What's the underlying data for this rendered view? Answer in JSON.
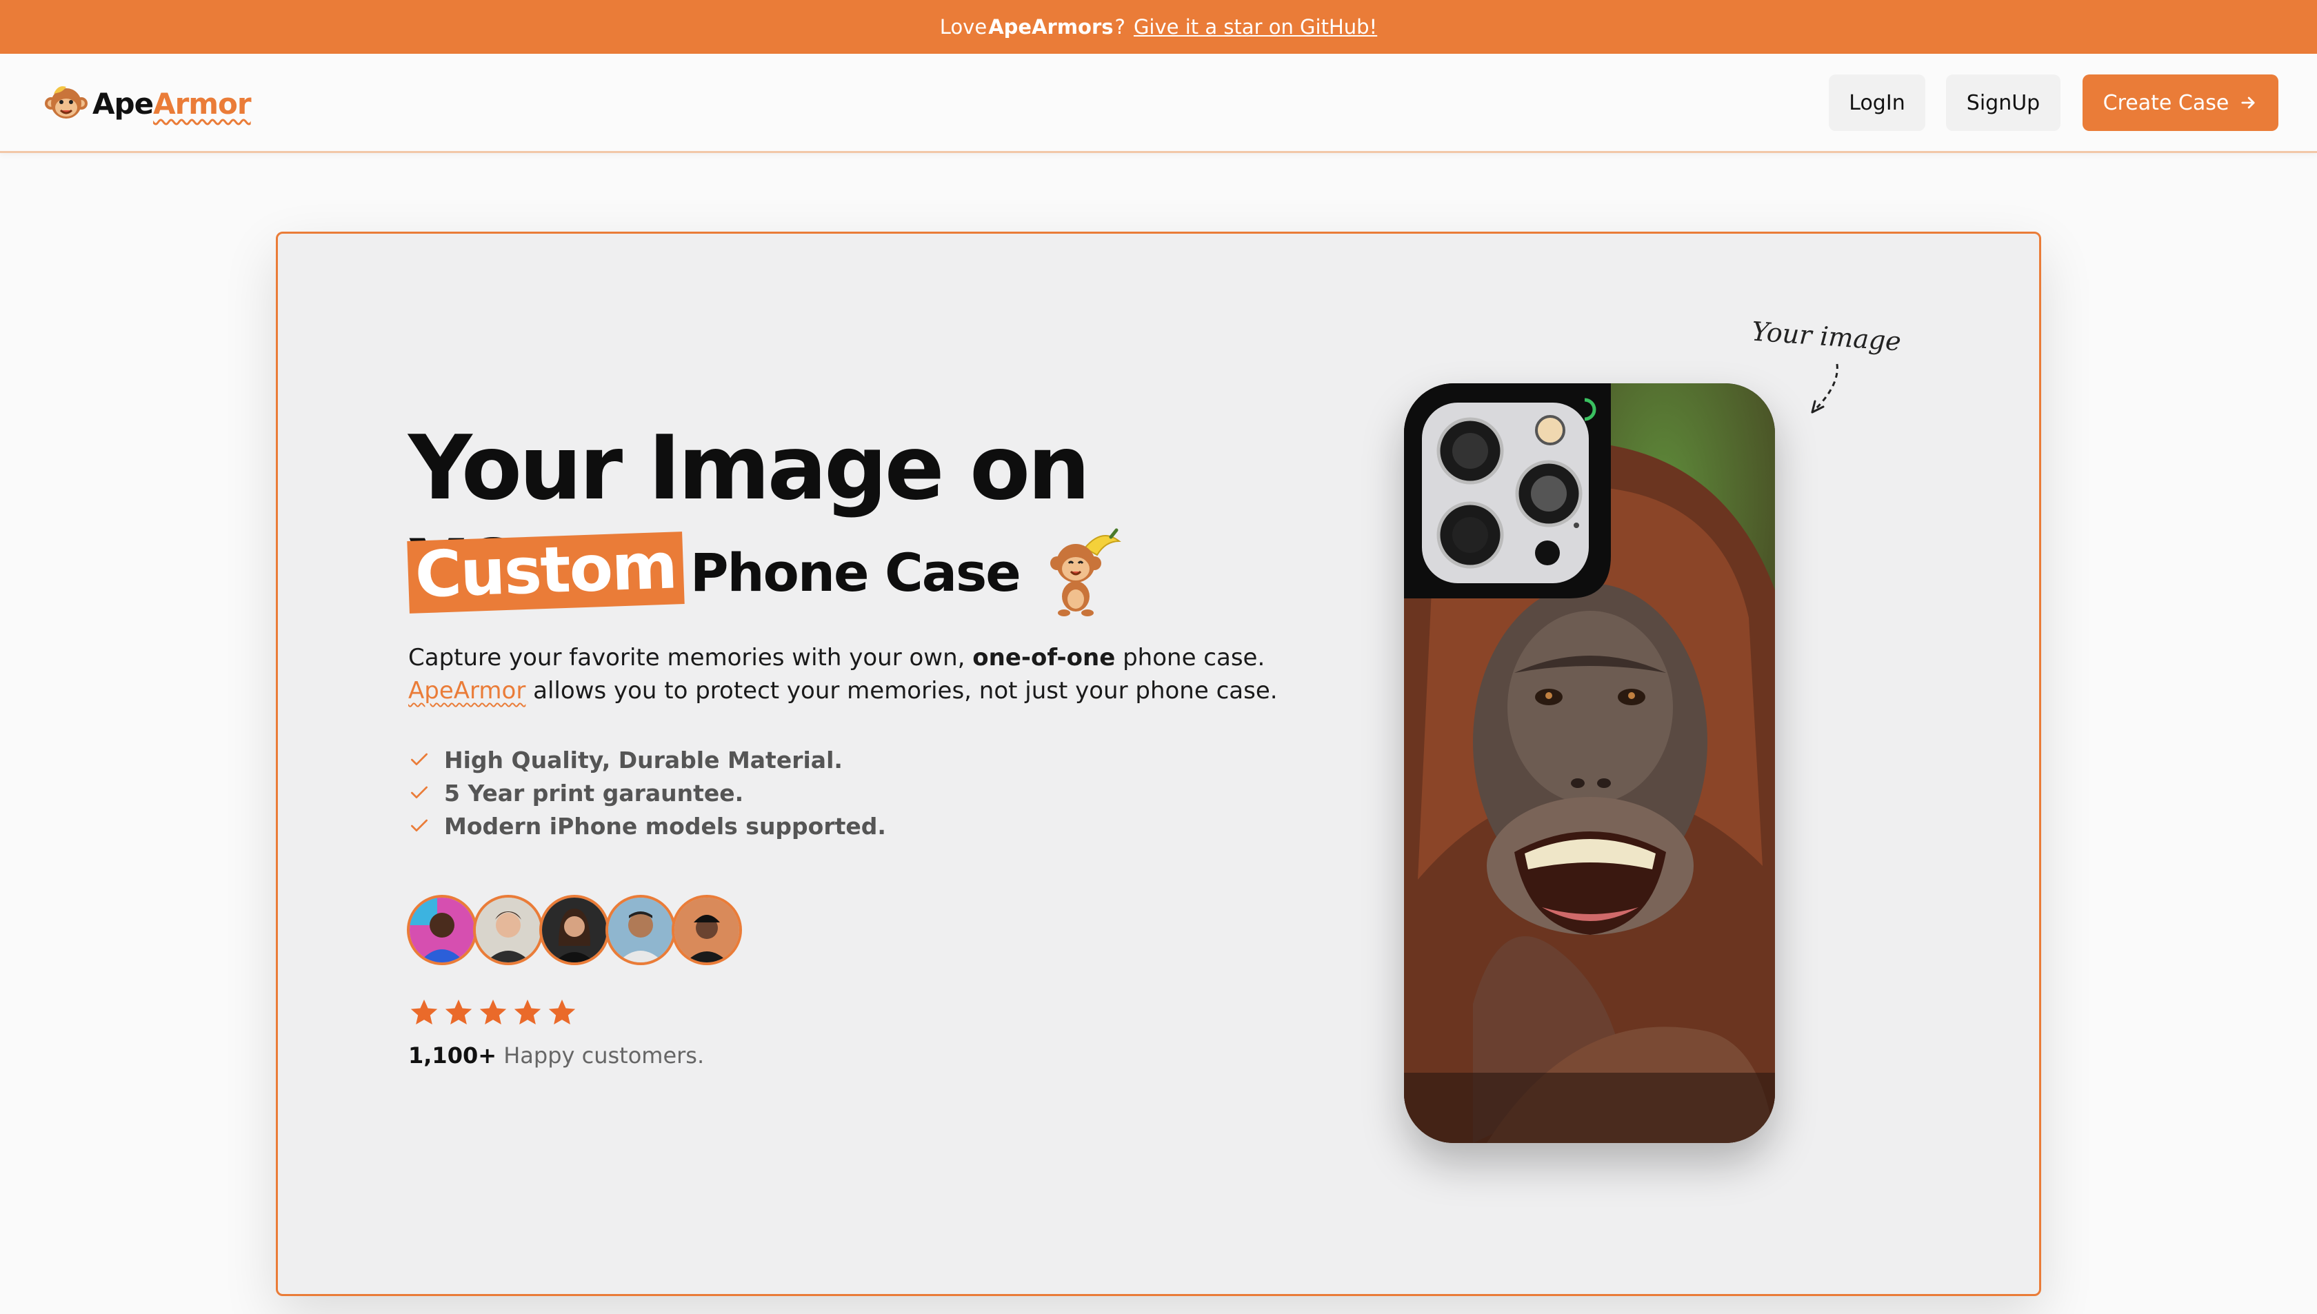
{
  "announcement": {
    "prefix": "Love",
    "brand": "ApeArmors",
    "suffix": "?",
    "link": "Give it a star on GitHub!"
  },
  "nav": {
    "logo_part1": "Ape",
    "logo_part2": "Armor",
    "login": "LogIn",
    "signup": "SignUp",
    "create": "Create Case"
  },
  "hero": {
    "headline": "Your Image on your",
    "custom": "Custom",
    "phone_case": "Phone Case",
    "desc_1": "Capture your favorite memories with your own, ",
    "desc_bold": "one-of-one",
    "desc_2": " phone case.",
    "desc_brand": "ApeArmor",
    "desc_3": " allows you to protect your memories, not just your phone case.",
    "features": [
      "High Quality, Durable Material.",
      "5 Year print garauntee.",
      "Modern iPhone models supported."
    ],
    "rating": 5,
    "customers_count": "1,100+",
    "customers_label": " Happy customers.",
    "note": "Your image"
  },
  "colors": {
    "accent": "#ea7c38",
    "card_bg": "#efeff0"
  }
}
